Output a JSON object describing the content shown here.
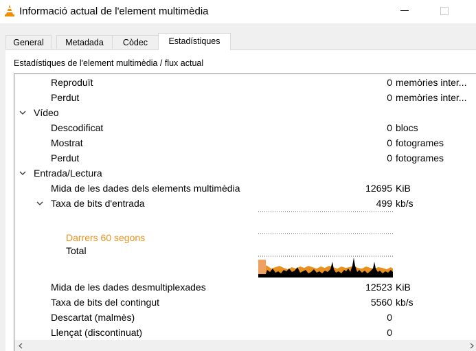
{
  "window": {
    "title": "Informació actual de l'element multimèdia"
  },
  "tabs": [
    {
      "label": "General"
    },
    {
      "label": "Metadada"
    },
    {
      "label": "Còdec"
    },
    {
      "label": "Estadístiques"
    }
  ],
  "section_title": "Estadístiques de l'element multimèdia / flux actual",
  "stats": {
    "audio_played": {
      "label": "Reproduït",
      "value": "0",
      "unit": "memòries inter..."
    },
    "audio_lost": {
      "label": "Perdut",
      "value": "0",
      "unit": "memòries inter..."
    },
    "video_group": {
      "label": "Vídeo"
    },
    "video_decoded": {
      "label": "Descodificat",
      "value": "0",
      "unit": "blocs"
    },
    "video_shown": {
      "label": "Mostrat",
      "value": "0",
      "unit": "fotogrames"
    },
    "video_lost": {
      "label": "Perdut",
      "value": "0",
      "unit": "fotogrames"
    },
    "input_group": {
      "label": "Entrada/Lectura"
    },
    "media_data_size": {
      "label": "Mida de les dades dels elements multimèdia",
      "value": "12695",
      "unit": "KiB"
    },
    "input_bitrate": {
      "label": "Taxa de bits d'entrada",
      "value": "499",
      "unit": "kb/s"
    },
    "demux_data_size": {
      "label": "Mida de les dades desmultiplexades",
      "value": "12523",
      "unit": "KiB"
    },
    "content_bitrate": {
      "label": "Taxa de bits del contingut",
      "value": "5560",
      "unit": "kb/s"
    },
    "discarded": {
      "label": "Descartat (malmès)",
      "value": "0"
    },
    "dropped": {
      "label": "Llençat (discontinuat)",
      "value": "0"
    }
  },
  "graph": {
    "legend_recent": "Darrers 60 segons",
    "legend_total": "Total",
    "colors": {
      "recent": "#e8911e",
      "recent_light": "#f0a060",
      "total": "#000000"
    }
  },
  "icons": {
    "app": "vlc-cone-icon",
    "expand": "chevron-down-icon",
    "scroll_left": "arrow-left-icon",
    "scroll_right": "arrow-right-icon",
    "scroll_up": "arrow-up-icon"
  }
}
